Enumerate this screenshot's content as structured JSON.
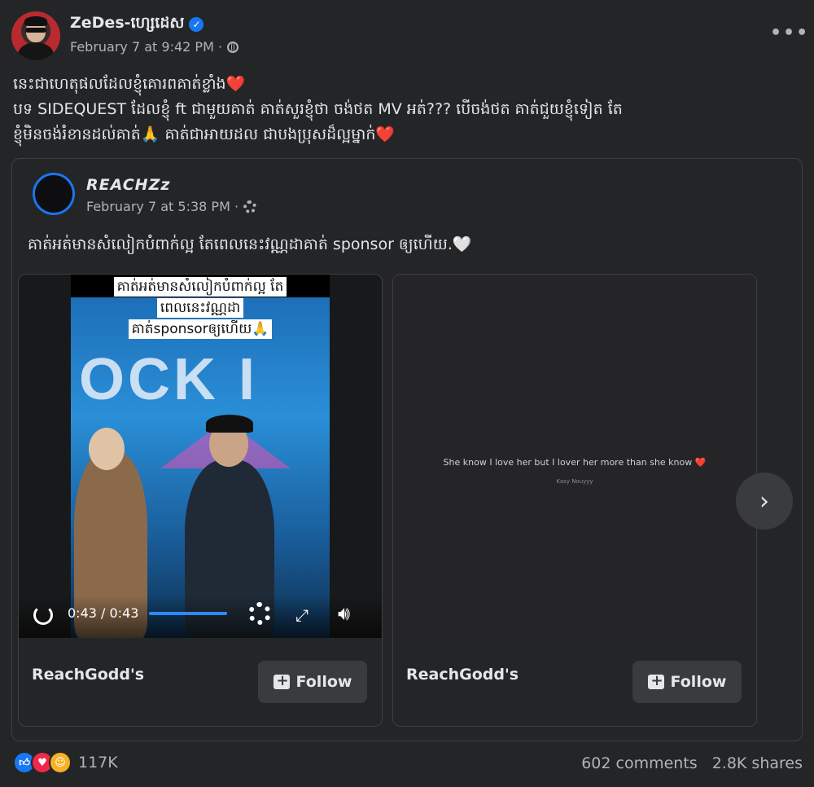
{
  "post": {
    "author": "ZeDes-ហ្សេដេស",
    "verified_mark": "✓",
    "timestamp": "February 7 at 9:42 PM ·",
    "more_label": "•••",
    "text_lines": [
      "នេះជាហេតុផលដែលខ្ញុំគោរពគាត់ខ្លាំង❤️",
      "បទ SIDEQUEST ដែលខ្ញុំ ft ជាមួយគាត់ គាត់សួរខ្ញុំថា ចង់ថត MV អត់??? បើចង់ថត គាត់ជួយខ្ញុំទៀត តែ",
      "ខ្ញុំមិនចង់រំខានដល់គាត់🙏 គាត់ជាអាយដល ជាបងប្រុសដ៏ល្អម្នាក់❤️"
    ]
  },
  "shared": {
    "author": "REACHZz",
    "timestamp": "February 7 at 5:38 PM ·",
    "text": "គាត់អត់មានសំលៀកបំពាក់ល្អ តែពេលនេះវណ្ណដាគាត់ sponsor ឲ្យហើយ.🤍",
    "cards": [
      {
        "caption_lines": [
          "គាត់អត់មានសំលៀកបំពាក់ល្អ តែ",
          "ពេលនេះវណ្ណដា",
          "គាត់sponsorឲ្យហើយ🙏"
        ],
        "stage_text": "OCK I",
        "video_time": "0:43 / 0:43",
        "progress": 1.0,
        "page_name": "ReachGodd's",
        "follow_label": "Follow"
      },
      {
        "quote": "She know I love her but I lover her more than she know ❤️",
        "quote_sub": "Kasy Nouyyy",
        "page_name": "ReachGodd's",
        "follow_label": "Follow"
      }
    ],
    "next_label": "›"
  },
  "engagement": {
    "reaction_count": "117K",
    "comments": "602 comments",
    "shares": "2.8K shares",
    "reactions": [
      "like-icon",
      "love-icon",
      "care-icon"
    ]
  },
  "colors": {
    "background": "#242526",
    "accent": "#1877f2",
    "text": "#e4e6eb",
    "muted": "#b0b3b8"
  }
}
